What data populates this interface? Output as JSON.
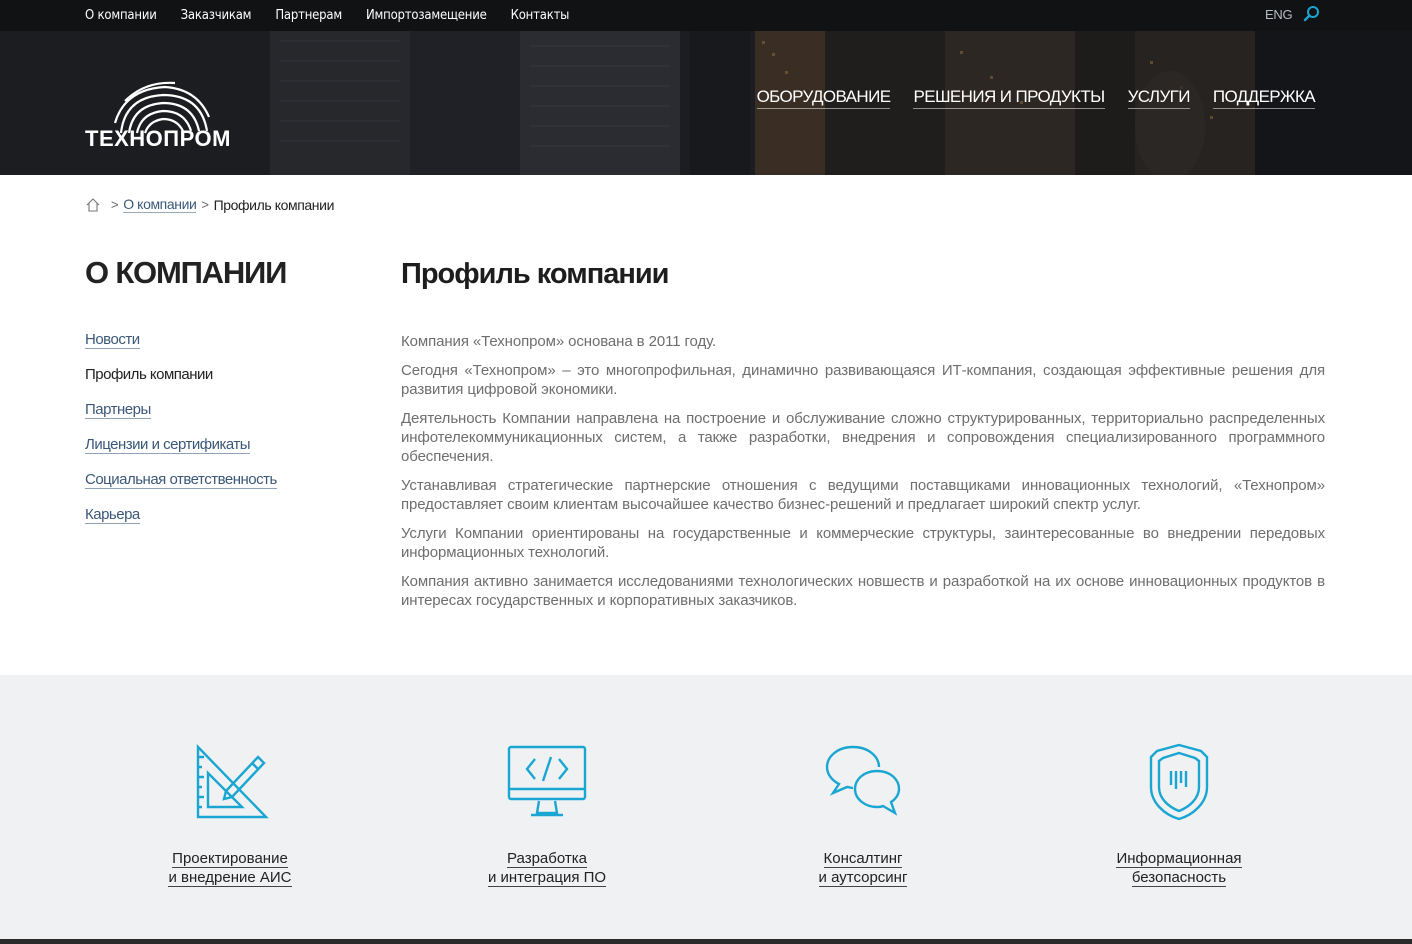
{
  "topnav": {
    "items": [
      "О компании",
      "Заказчикам",
      "Партнерам",
      "Импортозамещение",
      "Контакты"
    ],
    "lang": "ENG"
  },
  "header": {
    "logo_text": "ТЕХНОПРОМ",
    "mainnav": [
      "ОБОРУДОВАНИЕ",
      "РЕШЕНИЯ И ПРОДУКТЫ",
      "УСЛУГИ",
      "ПОДДЕРЖКА"
    ]
  },
  "breadcrumb": {
    "link": "О компании",
    "current": "Профиль компании",
    "separator": ">"
  },
  "sidebar": {
    "title": "О КОМПАНИИ",
    "items": [
      {
        "label": "Новости",
        "active": false
      },
      {
        "label": "Профиль компании",
        "active": true
      },
      {
        "label": "Партнеры",
        "active": false
      },
      {
        "label": "Лицензии и сертификаты",
        "active": false
      },
      {
        "label": "Социальная ответственность",
        "active": false
      },
      {
        "label": "Карьера",
        "active": false
      }
    ]
  },
  "main": {
    "title": "Профиль компании",
    "paragraphs": [
      "Компания «Технопром» основана в 2011 году.",
      "Сегодня «Технопром»  – это многопрофильная, динамично развивающаяся ИТ-компания, создающая эффективные решения для развития цифровой экономики.",
      "Деятельность Компании направлена на построение и обслуживание сложно структурированных, территориально распределенных инфотелекоммуникационных систем, а также разработки, внедрения и сопровождения специализированного программного обеспечения.",
      "Устанавливая стратегические партнерские отношения с ведущими поставщиками инновационных технологий, «Технопром» предоставляет своим клиентам высочайшее качество бизнес-решений и предлагает широкий спектр услуг.",
      "Услуги Компании ориентированы на государственные и коммерческие структуры, заинтересованные во внедрении передовых информационных технологий.",
      "Компания активно занимается исследованиями технологических новшеств и разработкой на их основе инновационных продуктов в интересах государственных и корпоративных заказчиков."
    ]
  },
  "services": [
    {
      "line1": "Проектирование",
      "line2": "и внедрение АИС",
      "icon": "design-tools-icon"
    },
    {
      "line1": "Разработка",
      "line2": "и интеграция ПО",
      "icon": "code-monitor-icon"
    },
    {
      "line1": "Консалтинг",
      "line2": "и аутсорсинг",
      "icon": "chat-bubbles-icon"
    },
    {
      "line1": "Информационная",
      "line2": "безопасность",
      "icon": "shield-icon"
    }
  ],
  "colors": {
    "accent": "#1aa6d2",
    "link": "#3b5878",
    "topbar": "#111214",
    "services_bg": "#f0f1f3"
  }
}
